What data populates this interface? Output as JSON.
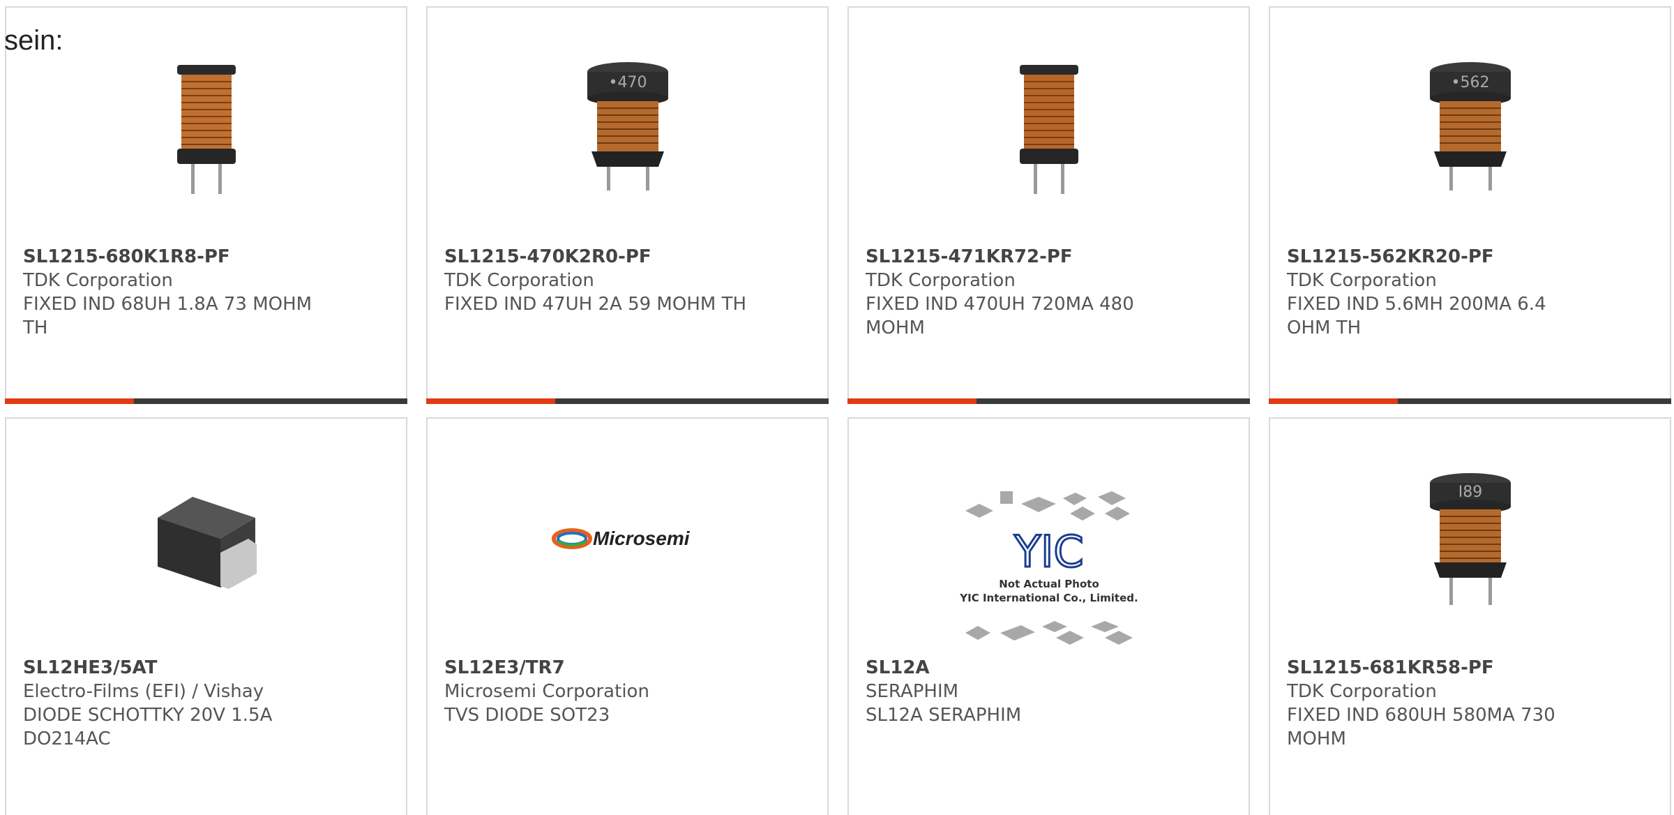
{
  "lead_text": "sein:",
  "colors": {
    "accent": "#e03b12",
    "bar": "#3a3a3a",
    "card_border": "#d9d9d9"
  },
  "products": [
    {
      "part": "SL1215-680K1R8-PF",
      "maker": "TDK Corporation",
      "desc": "FIXED IND 68UH 1.8A 73 MOHM TH",
      "image": "inductor-open-icon"
    },
    {
      "part": "SL1215-470K2R0-PF",
      "maker": "TDK Corporation",
      "desc": "FIXED IND 47UH 2A 59 MOHM TH",
      "image": "inductor-capped-icon",
      "cap_label": "•470"
    },
    {
      "part": "SL1215-471KR72-PF",
      "maker": "TDK Corporation",
      "desc": "FIXED IND 470UH 720MA 480 MOHM",
      "image": "inductor-open-icon"
    },
    {
      "part": "SL1215-562KR20-PF",
      "maker": "TDK Corporation",
      "desc": "FIXED IND 5.6MH 200MA 6.4 OHM TH",
      "image": "inductor-capped-icon",
      "cap_label": "•562"
    },
    {
      "part": "SL12HE3/5AT",
      "maker": "Electro-Films (EFI) / Vishay",
      "desc": "DIODE SCHOTTKY 20V 1.5A DO214AC",
      "image": "diode-smd-icon"
    },
    {
      "part": "SL12E3/TR7",
      "maker": "Microsemi Corporation",
      "desc": "TVS DIODE SOT23",
      "image": "microsemi-logo",
      "logo_text": "Microsemi"
    },
    {
      "part": "SL12A",
      "maker": "SERAPHIM",
      "desc": "SL12A SERAPHIM",
      "image": "yic-placeholder-icon",
      "placeholder_logo": "YIC",
      "placeholder_line1": "Not Actual Photo",
      "placeholder_line2": "YIC International Co., Limited."
    },
    {
      "part": "SL1215-681KR58-PF",
      "maker": "TDK Corporation",
      "desc": "FIXED IND 680UH 580MA 730 MOHM",
      "image": "inductor-capped-icon",
      "cap_label": "I89"
    }
  ]
}
